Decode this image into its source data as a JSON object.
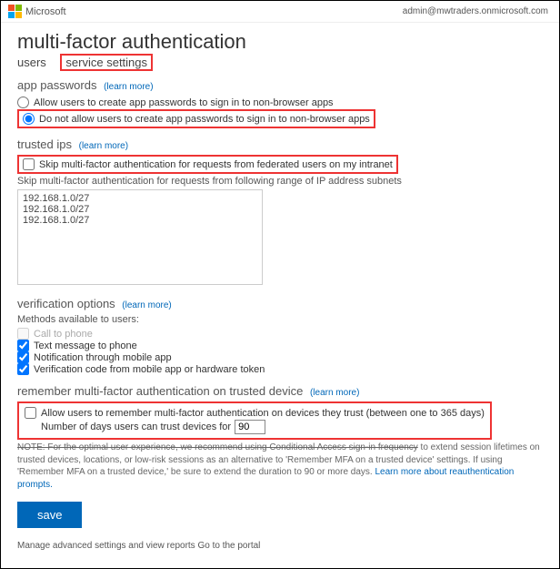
{
  "header": {
    "brand": "Microsoft",
    "admin": "admin@mwtraders.onmicrosoft.com"
  },
  "title": "multi-factor authentication",
  "tabs": {
    "users": "users",
    "service_settings": "service settings"
  },
  "app_passwords": {
    "heading": "app passwords",
    "learn": "(learn more)",
    "allow": "Allow users to create app passwords to sign in to non-browser apps",
    "deny": "Do not allow users to create app passwords to sign in to non-browser apps"
  },
  "trusted_ips": {
    "heading": "trusted ips",
    "learn": "(learn more)",
    "skip_federated": "Skip multi-factor authentication for requests from federated users on my intranet",
    "range_label": "Skip multi-factor authentication for requests from following range of IP address subnets",
    "ranges": "192.168.1.0/27\n192.168.1.0/27\n192.168.1.0/27"
  },
  "verification": {
    "heading": "verification options",
    "learn": "(learn more)",
    "methods_label": "Methods available to users:",
    "call": "Call to phone",
    "text": "Text message to phone",
    "app_notify": "Notification through mobile app",
    "app_code": "Verification code from mobile app or hardware token"
  },
  "remember": {
    "heading": "remember multi-factor authentication on trusted device",
    "learn": "(learn more)",
    "allow": "Allow users to remember multi-factor authentication on devices they trust (between one to 365 days)",
    "days_label": "Number of days users can trust devices for",
    "days_value": "90",
    "note_prefix": "NOTE: For the optimal user experience, we recommend using Conditional Access sign-in frequency",
    "note_rest": " to extend session lifetimes on trusted devices, locations, or low-risk sessions as an alternative to 'Remember MFA on a trusted device' settings. If using 'Remember MFA on a trusted device,' be sure to extend the duration to 90 or more days. ",
    "note_link": "Learn more about reauthentication prompts."
  },
  "save": "save",
  "cutoff": "Manage advanced settings and view reports Go to the portal"
}
